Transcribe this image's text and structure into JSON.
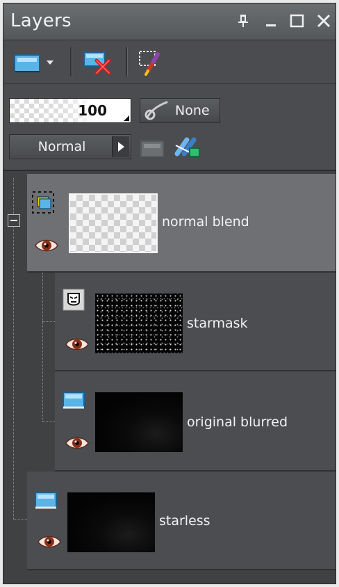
{
  "panel": {
    "title": "Layers",
    "title_buttons": [
      "pin-icon",
      "minimize-icon",
      "maximize-icon",
      "close-icon"
    ]
  },
  "toolbar": {
    "tools": [
      "new-raster-layer-icon",
      "dropdown-arrow-icon",
      "delete-layer-icon",
      "edit-selection-icon"
    ]
  },
  "properties": {
    "opacity": "100",
    "link_label": "None",
    "blend_mode": "Normal"
  },
  "layers": [
    {
      "name": "normal blend",
      "type": "group",
      "selected": true,
      "visible": true
    },
    {
      "name": "starmask",
      "type": "mask",
      "selected": false,
      "visible": true
    },
    {
      "name": "original blurred",
      "type": "raster",
      "selected": false,
      "visible": true
    },
    {
      "name": "starless",
      "type": "raster",
      "selected": false,
      "visible": true
    }
  ],
  "colors": {
    "panel_bg": "#3d3f41",
    "selected_row": "#6e7073",
    "row_bg": "#4b4d50",
    "text": "#f2f2f2"
  }
}
